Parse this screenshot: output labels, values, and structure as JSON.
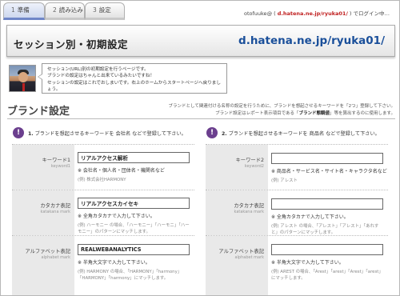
{
  "steps": [
    {
      "num": "1",
      "label": "準備"
    },
    {
      "num": "2",
      "label": "読み込み"
    },
    {
      "num": "3",
      "label": "設定"
    }
  ],
  "user": {
    "id": "otofuuke",
    "prefix": "@",
    "host": "d.hatena.ne.jp/ryuka01/",
    "suffix": "でログイン中…"
  },
  "header": {
    "title": "セッション別・初期設定",
    "domain": "d.hatena.ne.jp/ryuka01/"
  },
  "intro": {
    "lines": [
      "セッション(URL)別の初期設定を行うページです。",
      "ブランドの設定はちゃんと出来ているみたいですね！",
      "セッションの設定はこれでおしまいです。右上のホームからスタートページへ戻りましょう。"
    ]
  },
  "brand": {
    "title": "ブランド設定",
    "desc_line1": "ブランドとして関連付ける名称の設定を行うために、ブランドを想起させるキーワードを「2つ」登録して下さい。",
    "desc_line2a": "ブランド設定はレポート表示項目である「",
    "desc_bold": "ブランド態観値",
    "desc_line2b": "」等を算出するのに使用します。"
  },
  "left": {
    "badge": "!",
    "heading_num": "1.",
    "heading": "ブランドを想起させるキーワードを 会社名 などで登録して下さい。",
    "rows": [
      {
        "label": "キーワード1",
        "sub": "keyword1",
        "value": "リアルアクセス解析",
        "note": "※ 会社名・個人名・団体名・機関名など",
        "example": "(例) 株式会社HARMONY"
      },
      {
        "label": "カタカナ表記",
        "sub": "katakana mark",
        "value": "リアルアクセスカイセキ",
        "note": "※ 全角カタカナで入力して下さい。",
        "example": "(例) ハーモニー の場合、「ハーモニー」「ハーモニ」「ハーモニー」のパターンにマッチします。"
      },
      {
        "label": "アルファベット表記",
        "sub": "alphabet mark",
        "value": "REALWEBANALYTICS",
        "note": "※ 半角大文字で入力して下さい。",
        "example": "(例) HARMONY の場合、「HARMONY」「harmony」「HARMONY」「harmony」にマッチします。"
      }
    ]
  },
  "right": {
    "badge": "!",
    "heading_num": "2.",
    "heading": "ブランドを想起させるキーワードを 商品名 などで登録して下さい。",
    "rows": [
      {
        "label": "キーワード2",
        "sub": "keyword2",
        "value": "",
        "note": "※ 商品名・サービス名・サイト名・キャラクタ名など",
        "example": "(例) アレスト"
      },
      {
        "label": "カタカナ表記",
        "sub": "katakana mark",
        "value": "",
        "note": "※ 全角カタカナで入力して下さい。",
        "example": "(例) アレスト の場合、「アレスト」「アレスト」「あれすと」のパターンにマッチします。"
      },
      {
        "label": "アルファベット表記",
        "sub": "alphabet mark",
        "value": "",
        "note": "※ 半角大文字で入力して下さい。",
        "example": "(例) AREST の場合、「Arest」「arest」「Arest」「arest」にマッチします。"
      }
    ]
  }
}
